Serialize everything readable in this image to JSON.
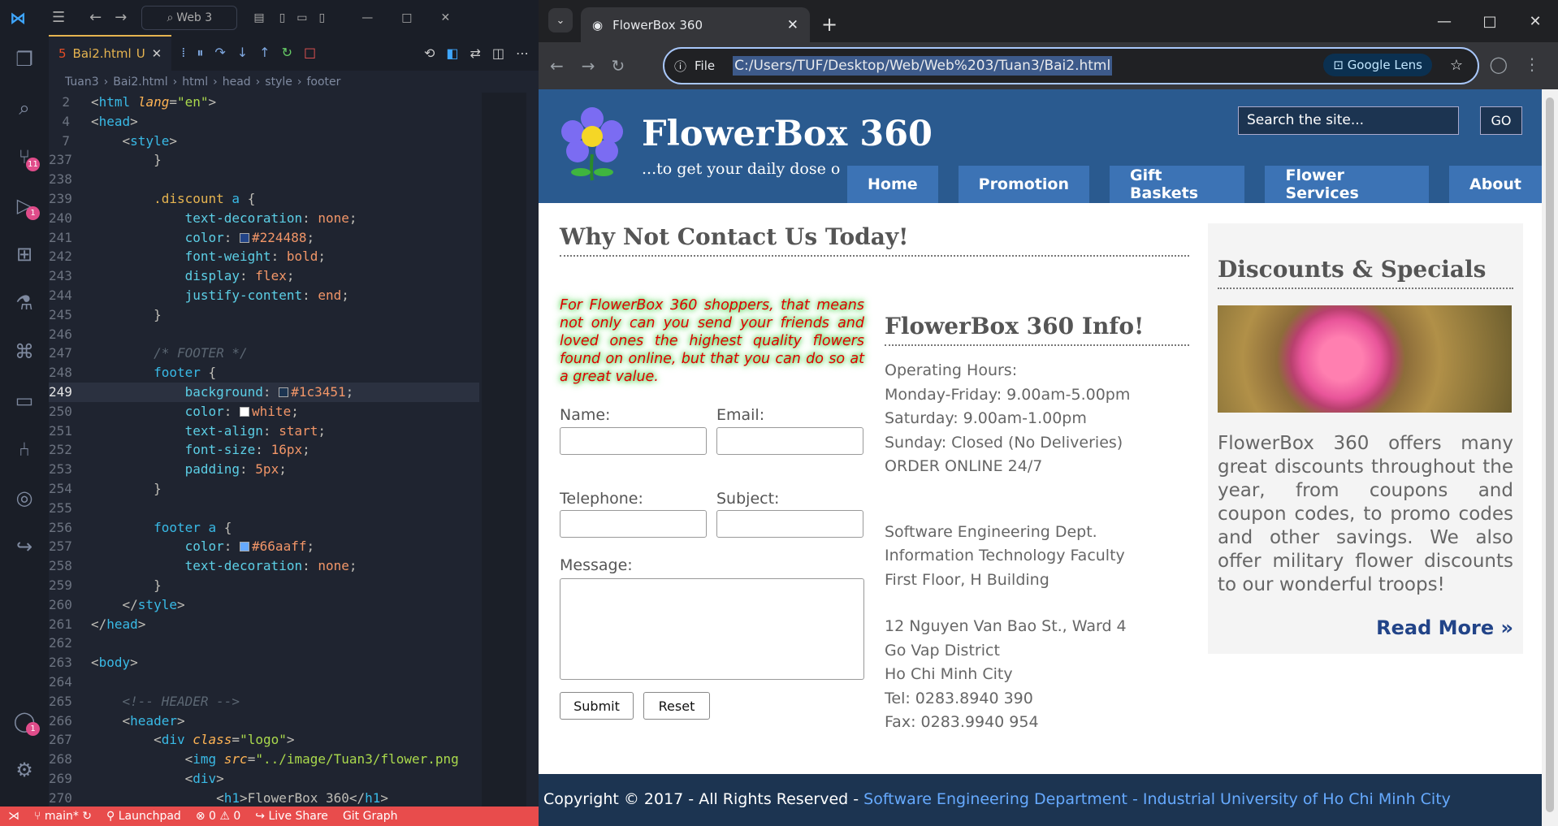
{
  "vscode": {
    "search": "Web 3",
    "tab": {
      "label": "Bai2.html",
      "status": "U"
    },
    "breadcrumb": [
      "Tuan3",
      "Bai2.html",
      "html",
      "head",
      "style",
      "footer"
    ],
    "badges": {
      "scm": "11",
      "debug": "1",
      "accounts": "1"
    },
    "lines": [
      {
        "n": "2",
        "html": "<span class=\"pl\">&lt;</span><span class=\"tg\">html</span> <span class=\"at\">lang</span><span class=\"pl\">=</span><span class=\"st\">\"en\"</span><span class=\"pl\">&gt;</span>"
      },
      {
        "n": "4",
        "html": "<span class=\"pl\">&lt;</span><span class=\"tg\">head</span><span class=\"pl\">&gt;</span>"
      },
      {
        "n": "7",
        "html": "    <span class=\"pl\">&lt;</span><span class=\"tg\">style</span><span class=\"pl\">&gt;</span>"
      },
      {
        "n": "237",
        "html": "        <span class=\"pl\">}</span>"
      },
      {
        "n": "238",
        "html": ""
      },
      {
        "n": "239",
        "html": "        <span class=\"cl\">.discount</span> <span class=\"tg\">a</span> <span class=\"pl\">{</span>"
      },
      {
        "n": "240",
        "html": "            <span class=\"pr\">text-decoration</span><span class=\"pl\">: </span><span class=\"vl\">none</span><span class=\"pl\">;</span>"
      },
      {
        "n": "241",
        "html": "            <span class=\"pr\">color</span><span class=\"pl\">: </span><span class=\"sw\" style=\"background:#224488\"></span><span class=\"vl\">#224488</span><span class=\"pl\">;</span>"
      },
      {
        "n": "242",
        "html": "            <span class=\"pr\">font-weight</span><span class=\"pl\">: </span><span class=\"vl\">bold</span><span class=\"pl\">;</span>"
      },
      {
        "n": "243",
        "html": "            <span class=\"pr\">display</span><span class=\"pl\">: </span><span class=\"vl\">flex</span><span class=\"pl\">;</span>"
      },
      {
        "n": "244",
        "html": "            <span class=\"pr\">justify-content</span><span class=\"pl\">: </span><span class=\"vl\">end</span><span class=\"pl\">;</span>"
      },
      {
        "n": "245",
        "html": "        <span class=\"pl\">}</span>"
      },
      {
        "n": "246",
        "html": ""
      },
      {
        "n": "247",
        "html": "        <span class=\"cm\">/* FOOTER */</span>"
      },
      {
        "n": "248",
        "html": "        <span class=\"tg\">footer</span> <span class=\"pl\">{</span>"
      },
      {
        "n": "249",
        "html": "            <span class=\"pr\">background</span><span class=\"pl\">: </span><span class=\"sw\" style=\"background:#1c3451\"></span><span class=\"vl\">#1c3451</span><span class=\"pl\">;</span>",
        "cur": true
      },
      {
        "n": "250",
        "html": "            <span class=\"pr\">color</span><span class=\"pl\">: </span><span class=\"sw\" style=\"background:#fff\"></span><span class=\"vl\">white</span><span class=\"pl\">;</span>"
      },
      {
        "n": "251",
        "html": "            <span class=\"pr\">text-align</span><span class=\"pl\">: </span><span class=\"vl\">start</span><span class=\"pl\">;</span>"
      },
      {
        "n": "252",
        "html": "            <span class=\"pr\">font-size</span><span class=\"pl\">: </span><span class=\"vl\">16px</span><span class=\"pl\">;</span>"
      },
      {
        "n": "253",
        "html": "            <span class=\"pr\">padding</span><span class=\"pl\">: </span><span class=\"vl\">5px</span><span class=\"pl\">;</span>"
      },
      {
        "n": "254",
        "html": "        <span class=\"pl\">}</span>"
      },
      {
        "n": "255",
        "html": ""
      },
      {
        "n": "256",
        "html": "        <span class=\"tg\">footer a</span> <span class=\"pl\">{</span>"
      },
      {
        "n": "257",
        "html": "            <span class=\"pr\">color</span><span class=\"pl\">: </span><span class=\"sw\" style=\"background:#66aaff\"></span><span class=\"vl\">#66aaff</span><span class=\"pl\">;</span>"
      },
      {
        "n": "258",
        "html": "            <span class=\"pr\">text-decoration</span><span class=\"pl\">: </span><span class=\"vl\">none</span><span class=\"pl\">;</span>"
      },
      {
        "n": "259",
        "html": "        <span class=\"pl\">}</span>"
      },
      {
        "n": "260",
        "html": "    <span class=\"pl\">&lt;/</span><span class=\"tg\">style</span><span class=\"pl\">&gt;</span>"
      },
      {
        "n": "261",
        "html": "<span class=\"pl\">&lt;/</span><span class=\"tg\">head</span><span class=\"pl\">&gt;</span>"
      },
      {
        "n": "262",
        "html": ""
      },
      {
        "n": "263",
        "html": "<span class=\"pl\">&lt;</span><span class=\"tg\">body</span><span class=\"pl\">&gt;</span>"
      },
      {
        "n": "264",
        "html": ""
      },
      {
        "n": "265",
        "html": "    <span class=\"cm\">&lt;!-- HEADER --&gt;</span>"
      },
      {
        "n": "266",
        "html": "    <span class=\"pl\">&lt;</span><span class=\"tg\">header</span><span class=\"pl\">&gt;</span>"
      },
      {
        "n": "267",
        "html": "        <span class=\"pl\">&lt;</span><span class=\"tg\">div</span> <span class=\"at\">class</span><span class=\"pl\">=</span><span class=\"st\">\"logo\"</span><span class=\"pl\">&gt;</span>"
      },
      {
        "n": "268",
        "html": "            <span class=\"pl\">&lt;</span><span class=\"tg\">img</span> <span class=\"at\">src</span><span class=\"pl\">=</span><span class=\"st\">\"../image/Tuan3/flower.png</span>"
      },
      {
        "n": "269",
        "html": "            <span class=\"pl\">&lt;</span><span class=\"tg\">div</span><span class=\"pl\">&gt;</span>"
      },
      {
        "n": "270",
        "html": "                <span class=\"pl\">&lt;</span><span class=\"tg\">h1</span><span class=\"pl\">&gt;FlowerBox 360&lt;/</span><span class=\"tg\">h1</span><span class=\"pl\">&gt;</span>"
      }
    ],
    "status": {
      "branch": "main*",
      "launchpad": "Launchpad",
      "problems": "0",
      "warnings": "0",
      "liveshare": "Live Share",
      "gitgraph": "Git Graph"
    }
  },
  "browser": {
    "tab_title": "FlowerBox 360",
    "scheme": "File",
    "url": "C:/Users/TUF/Desktop/Web/Web%203/Tuan3/Bai2.html",
    "lens": "Google Lens"
  },
  "site": {
    "title": "FlowerBox 360",
    "tagline": "...to get your daily dose of lu",
    "search_placeholder": "Search the site...",
    "go": "GO",
    "nav": [
      "Home",
      "Promotion",
      "Gift Baskets",
      "Flower Services",
      "About"
    ],
    "contact_heading": "Why Not Contact Us Today!",
    "promo": "For FlowerBox 360 shoppers, that means not only can you send your friends and loved ones the highest quality flowers found on online, but that you can do so at a great value.",
    "form": {
      "name": "Name:",
      "email": "Email:",
      "telephone": "Telephone:",
      "subject": "Subject:",
      "message": "Message:",
      "submit": "Submit",
      "reset": "Reset"
    },
    "info_heading": "FlowerBox 360 Info!",
    "hours": [
      "Operating Hours:",
      "Monday-Friday: 9.00am-5.00pm",
      "Saturday: 9.00am-1.00pm",
      "Sunday: Closed (No Deliveries)",
      "ORDER ONLINE 24/7"
    ],
    "dept": [
      "Software Engineering Dept.",
      "Information Technology Faculty",
      "First Floor, H Building"
    ],
    "address": [
      "12 Nguyen Van Bao St., Ward 4",
      "Go Vap District",
      "Ho Chi Minh City",
      "Tel: 0283.8940 390",
      "Fax: 0283.9940 954"
    ],
    "discounts_heading": "Discounts & Specials",
    "discounts_text": "FlowerBox 360 offers many great discounts throughout the year, from coupons and coupon codes, to promo codes and other savings. We also offer military flower discounts to our wonderful troops!",
    "read_more": "Read More »",
    "footer_copy": "Copyright © 2017 - All Rights Reserved - ",
    "footer_link1": "Software Engineering Department",
    "footer_sep": " - ",
    "footer_link2": "Industrial University of Ho Chi Minh City"
  }
}
